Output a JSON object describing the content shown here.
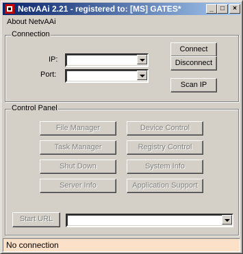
{
  "window": {
    "title": "NetvAAi 2.21 - registered to: [MS] GATES*"
  },
  "titlebar_buttons": {
    "minimize": "_",
    "maximize": "□",
    "close": "×"
  },
  "menubar": {
    "items": [
      "About NetvAAi"
    ]
  },
  "connection": {
    "group_label": "Connection",
    "ip_label": "IP:",
    "ip_value": "",
    "port_label": "Port:",
    "port_value": "",
    "connect_label": "Connect",
    "disconnect_label": "Disconnect",
    "scan_ip_label": "Scan IP"
  },
  "control_panel": {
    "group_label": "Control Panel",
    "buttons": [
      "File Manager",
      "Device Control",
      "Task Manager",
      "Registry Control",
      "Shut Down",
      "System Info",
      "Server Info",
      "Application Support"
    ],
    "start_url_label": "Start URL",
    "url_value": ""
  },
  "status": {
    "text": "No connection"
  },
  "colors": {
    "title_start": "#0a246a",
    "title_end": "#a6caf0",
    "status_bg": "#fde0c8",
    "face": "#d4d0c8"
  }
}
